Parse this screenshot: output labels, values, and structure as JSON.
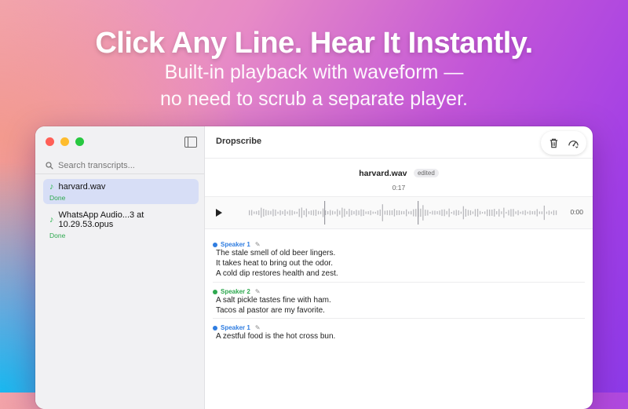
{
  "hero": {
    "headline": "Click Any Line. Hear It Instantly.",
    "sub_line1": "Built-in playback with waveform —",
    "sub_line2": "no need to scrub a separate player."
  },
  "app": {
    "title": "Dropscribe",
    "search_placeholder": "Search transcripts...",
    "files": [
      {
        "name": "harvard.wav",
        "status": "Done",
        "selected": true
      },
      {
        "name": "WhatsApp Audio...3 at 10.29.53.opus",
        "status": "Done",
        "selected": false
      }
    ],
    "current": {
      "name": "harvard.wav",
      "badge": "edited",
      "duration": "0:17"
    },
    "player": {
      "time": "0:00"
    },
    "segments": [
      {
        "speaker": "Speaker 1",
        "color": "#2f7de1",
        "lines": [
          "The stale smell of old beer lingers.",
          "It takes heat to bring out the odor.",
          "A cold dip restores health and zest."
        ]
      },
      {
        "speaker": "Speaker 2",
        "color": "#2ea84f",
        "lines": [
          "A salt pickle tastes fine with ham.",
          "Tacos al pastor are my favorite."
        ]
      },
      {
        "speaker": "Speaker 1",
        "color": "#2f7de1",
        "lines": [
          "A zestful food is the hot cross bun."
        ]
      }
    ]
  },
  "icons": [
    "search-icon",
    "sidebar-toggle-icon",
    "music-note-icon",
    "trash-icon",
    "speed-gauge-icon",
    "play-icon",
    "pencil-icon"
  ]
}
